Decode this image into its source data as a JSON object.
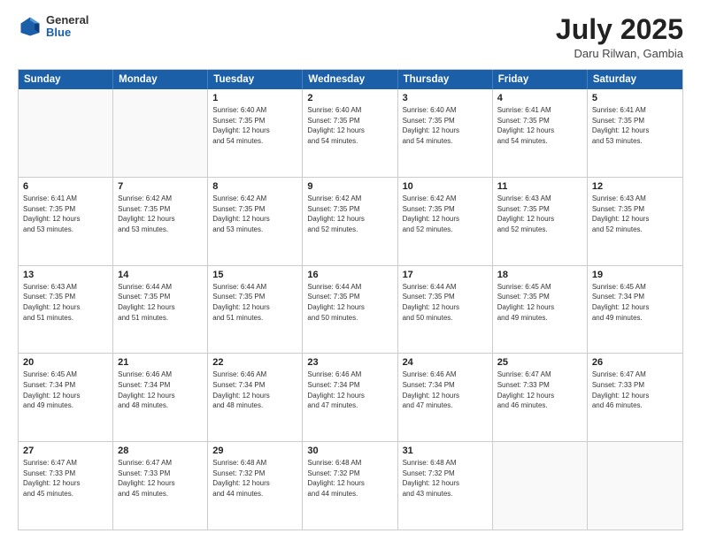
{
  "header": {
    "logo_general": "General",
    "logo_blue": "Blue",
    "month_year": "July 2025",
    "location": "Daru Rilwan, Gambia"
  },
  "weekdays": [
    "Sunday",
    "Monday",
    "Tuesday",
    "Wednesday",
    "Thursday",
    "Friday",
    "Saturday"
  ],
  "rows": [
    [
      {
        "day": "",
        "text": ""
      },
      {
        "day": "",
        "text": ""
      },
      {
        "day": "1",
        "text": "Sunrise: 6:40 AM\nSunset: 7:35 PM\nDaylight: 12 hours\nand 54 minutes."
      },
      {
        "day": "2",
        "text": "Sunrise: 6:40 AM\nSunset: 7:35 PM\nDaylight: 12 hours\nand 54 minutes."
      },
      {
        "day": "3",
        "text": "Sunrise: 6:40 AM\nSunset: 7:35 PM\nDaylight: 12 hours\nand 54 minutes."
      },
      {
        "day": "4",
        "text": "Sunrise: 6:41 AM\nSunset: 7:35 PM\nDaylight: 12 hours\nand 54 minutes."
      },
      {
        "day": "5",
        "text": "Sunrise: 6:41 AM\nSunset: 7:35 PM\nDaylight: 12 hours\nand 53 minutes."
      }
    ],
    [
      {
        "day": "6",
        "text": "Sunrise: 6:41 AM\nSunset: 7:35 PM\nDaylight: 12 hours\nand 53 minutes."
      },
      {
        "day": "7",
        "text": "Sunrise: 6:42 AM\nSunset: 7:35 PM\nDaylight: 12 hours\nand 53 minutes."
      },
      {
        "day": "8",
        "text": "Sunrise: 6:42 AM\nSunset: 7:35 PM\nDaylight: 12 hours\nand 53 minutes."
      },
      {
        "day": "9",
        "text": "Sunrise: 6:42 AM\nSunset: 7:35 PM\nDaylight: 12 hours\nand 52 minutes."
      },
      {
        "day": "10",
        "text": "Sunrise: 6:42 AM\nSunset: 7:35 PM\nDaylight: 12 hours\nand 52 minutes."
      },
      {
        "day": "11",
        "text": "Sunrise: 6:43 AM\nSunset: 7:35 PM\nDaylight: 12 hours\nand 52 minutes."
      },
      {
        "day": "12",
        "text": "Sunrise: 6:43 AM\nSunset: 7:35 PM\nDaylight: 12 hours\nand 52 minutes."
      }
    ],
    [
      {
        "day": "13",
        "text": "Sunrise: 6:43 AM\nSunset: 7:35 PM\nDaylight: 12 hours\nand 51 minutes."
      },
      {
        "day": "14",
        "text": "Sunrise: 6:44 AM\nSunset: 7:35 PM\nDaylight: 12 hours\nand 51 minutes."
      },
      {
        "day": "15",
        "text": "Sunrise: 6:44 AM\nSunset: 7:35 PM\nDaylight: 12 hours\nand 51 minutes."
      },
      {
        "day": "16",
        "text": "Sunrise: 6:44 AM\nSunset: 7:35 PM\nDaylight: 12 hours\nand 50 minutes."
      },
      {
        "day": "17",
        "text": "Sunrise: 6:44 AM\nSunset: 7:35 PM\nDaylight: 12 hours\nand 50 minutes."
      },
      {
        "day": "18",
        "text": "Sunrise: 6:45 AM\nSunset: 7:35 PM\nDaylight: 12 hours\nand 49 minutes."
      },
      {
        "day": "19",
        "text": "Sunrise: 6:45 AM\nSunset: 7:34 PM\nDaylight: 12 hours\nand 49 minutes."
      }
    ],
    [
      {
        "day": "20",
        "text": "Sunrise: 6:45 AM\nSunset: 7:34 PM\nDaylight: 12 hours\nand 49 minutes."
      },
      {
        "day": "21",
        "text": "Sunrise: 6:46 AM\nSunset: 7:34 PM\nDaylight: 12 hours\nand 48 minutes."
      },
      {
        "day": "22",
        "text": "Sunrise: 6:46 AM\nSunset: 7:34 PM\nDaylight: 12 hours\nand 48 minutes."
      },
      {
        "day": "23",
        "text": "Sunrise: 6:46 AM\nSunset: 7:34 PM\nDaylight: 12 hours\nand 47 minutes."
      },
      {
        "day": "24",
        "text": "Sunrise: 6:46 AM\nSunset: 7:34 PM\nDaylight: 12 hours\nand 47 minutes."
      },
      {
        "day": "25",
        "text": "Sunrise: 6:47 AM\nSunset: 7:33 PM\nDaylight: 12 hours\nand 46 minutes."
      },
      {
        "day": "26",
        "text": "Sunrise: 6:47 AM\nSunset: 7:33 PM\nDaylight: 12 hours\nand 46 minutes."
      }
    ],
    [
      {
        "day": "27",
        "text": "Sunrise: 6:47 AM\nSunset: 7:33 PM\nDaylight: 12 hours\nand 45 minutes."
      },
      {
        "day": "28",
        "text": "Sunrise: 6:47 AM\nSunset: 7:33 PM\nDaylight: 12 hours\nand 45 minutes."
      },
      {
        "day": "29",
        "text": "Sunrise: 6:48 AM\nSunset: 7:32 PM\nDaylight: 12 hours\nand 44 minutes."
      },
      {
        "day": "30",
        "text": "Sunrise: 6:48 AM\nSunset: 7:32 PM\nDaylight: 12 hours\nand 44 minutes."
      },
      {
        "day": "31",
        "text": "Sunrise: 6:48 AM\nSunset: 7:32 PM\nDaylight: 12 hours\nand 43 minutes."
      },
      {
        "day": "",
        "text": ""
      },
      {
        "day": "",
        "text": ""
      }
    ]
  ]
}
